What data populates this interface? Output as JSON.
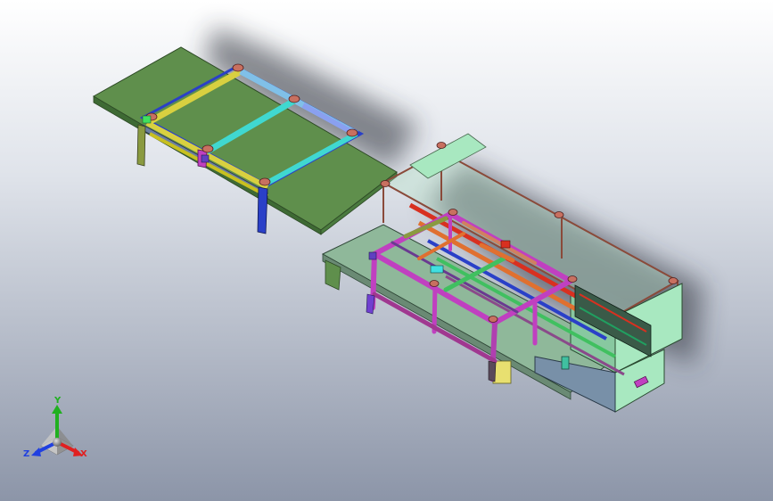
{
  "viewport": {
    "background_top": "#ffffff",
    "background_bottom": "#8c95a8"
  },
  "model": {
    "colors": {
      "table_top": "#5f8f4c",
      "table_edge": "#3e6a34",
      "frame_magenta": "#c040c0",
      "frame_brown": "#8a4a3a",
      "frame_green": "#40c060",
      "frame_cyan": "#40d8d0",
      "frame_yellow": "#d8d040",
      "frame_blue": "#2a40c8",
      "panel_mint": "#a8e8c0",
      "panel_steel": "#7890a8",
      "accent_red": "#d83020",
      "accent_orange": "#e07030"
    }
  },
  "triad": {
    "y_label": "Y",
    "z_label": "Z",
    "x_label": "X",
    "y_color": "#20b020",
    "z_color": "#2040e0",
    "x_color": "#e02020"
  }
}
